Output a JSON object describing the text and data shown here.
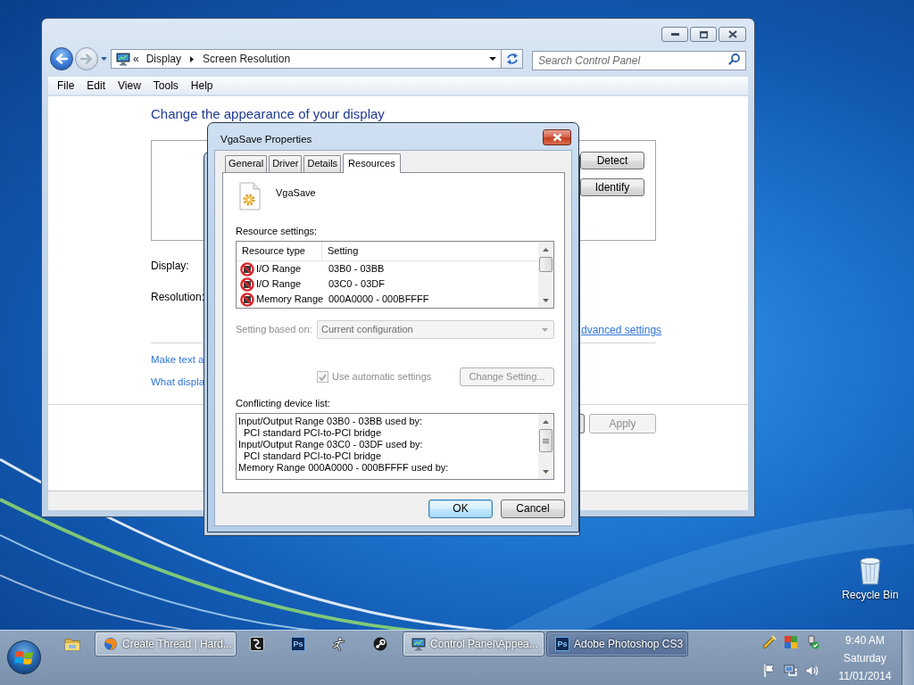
{
  "desktop": {
    "icons": [
      {
        "label": "Recycle Bin"
      }
    ]
  },
  "control_panel": {
    "address": {
      "overflow": "«",
      "crumbs": [
        "Display",
        "Screen Resolution"
      ]
    },
    "search": {
      "placeholder": "Search Control Panel"
    },
    "menu": [
      "File",
      "Edit",
      "View",
      "Tools",
      "Help"
    ],
    "heading": "Change the appearance of your display",
    "monitor_buttons": [
      {
        "label": "Detect"
      },
      {
        "label": "Identify"
      }
    ],
    "field_labels": [
      "Display:",
      "Resolution:"
    ],
    "advanced_link": "dvanced settings",
    "links": [
      "Make text a",
      "What displa"
    ],
    "apply_button": {
      "label": "Apply",
      "disabled": true
    }
  },
  "dialog": {
    "title": "VgaSave Properties",
    "tabs": [
      {
        "label": "General",
        "selected": false
      },
      {
        "label": "Driver",
        "selected": false
      },
      {
        "label": "Details",
        "selected": false
      },
      {
        "label": "Resources",
        "selected": true
      }
    ],
    "device_name": "VgaSave",
    "resource_label": "Resource settings:",
    "resource_table": {
      "columns": [
        "Resource type",
        "Setting"
      ],
      "rows": [
        {
          "type": "I/O Range",
          "setting": "03B0 - 03BB",
          "conflict": true
        },
        {
          "type": "I/O Range",
          "setting": "03C0 - 03DF",
          "conflict": true
        },
        {
          "type": "Memory Range",
          "setting": "000A0000 - 000BFFFF",
          "conflict": true
        }
      ]
    },
    "setting_based_on": {
      "label": "Setting based on:",
      "value": "Current configuration",
      "disabled": true
    },
    "automatic_settings": {
      "label": "Use automatic settings",
      "checked": true,
      "disabled": true
    },
    "change_setting_button": {
      "label": "Change Setting...",
      "disabled": true
    },
    "conflict_label": "Conflicting device list:",
    "conflict_list": [
      {
        "text": "Input/Output Range 03B0 - 03BB used by:",
        "children": [
          {
            "text": "PCI standard PCI-to-PCI bridge"
          }
        ]
      },
      {
        "text": "Input/Output Range 03C0 - 03DF used by:",
        "children": [
          {
            "text": "PCI standard PCI-to-PCI bridge"
          }
        ]
      },
      {
        "text": "Memory Range 000A0000 - 000BFFFF used by:"
      }
    ],
    "buttons": [
      {
        "label": "OK",
        "default": true
      },
      {
        "label": "Cancel",
        "default": false
      }
    ]
  },
  "taskbar": {
    "items": [
      {
        "kind": "folder"
      },
      {
        "kind": "browser",
        "label": "Create Thread | Hard...",
        "highlighted": true
      },
      {
        "kind": "tile"
      },
      {
        "kind": "photoshop",
        "icon_text": "Ps"
      },
      {
        "kind": "figure"
      },
      {
        "kind": "disc"
      },
      {
        "kind": "controlpanel",
        "label": "Control Panel\\Appea...",
        "highlighted": true
      },
      {
        "kind": "photoshop",
        "icon_text": "Ps",
        "label": "Adobe Photoshop CS3",
        "highlighted": false
      }
    ],
    "clock": {
      "time": "9:40 AM",
      "day": "Saturday",
      "date": "11/01/2014"
    }
  }
}
